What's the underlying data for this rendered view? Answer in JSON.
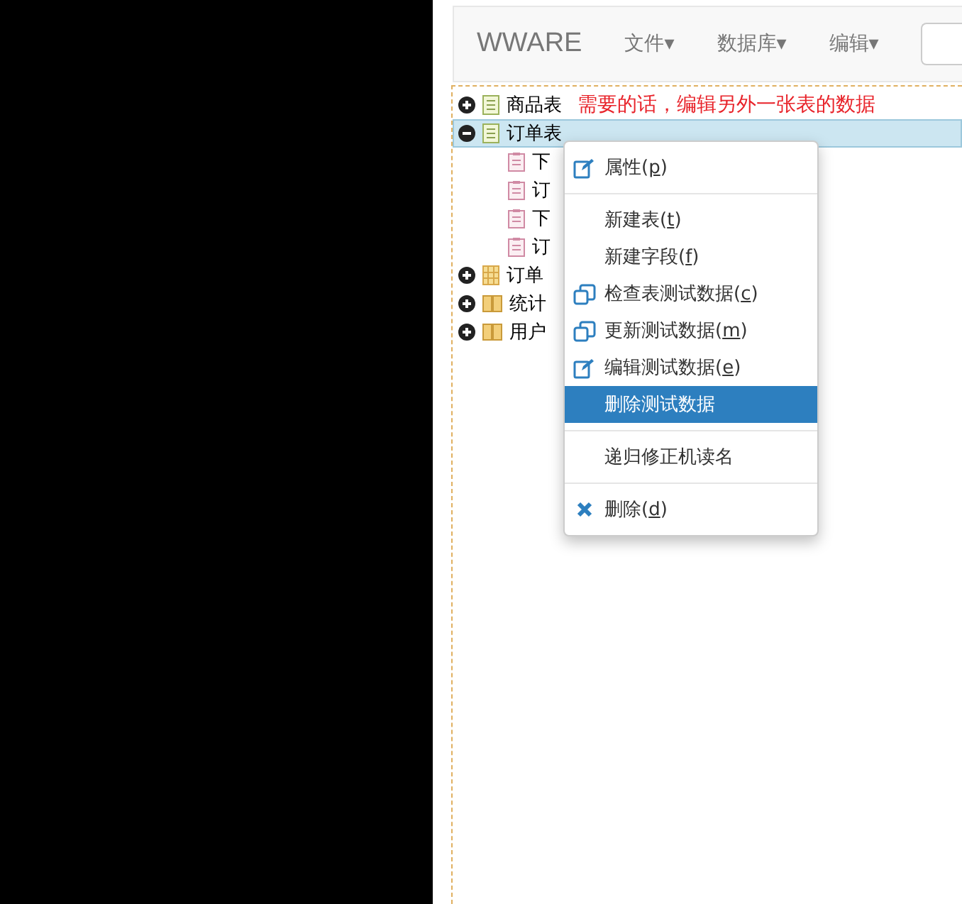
{
  "navbar": {
    "brand": "WWARE",
    "menus": [
      {
        "label": "文件",
        "caret": "▾"
      },
      {
        "label": "数据库",
        "caret": "▾"
      },
      {
        "label": "编辑",
        "caret": "▾"
      }
    ],
    "search": {
      "kind": "field"
    }
  },
  "tree": [
    {
      "label": "商品表",
      "kind": "table",
      "expanded": false,
      "selected": false,
      "note": "需要的话，编辑另外一张表的数据"
    },
    {
      "label": "订单表",
      "kind": "table",
      "expanded": true,
      "selected": true,
      "children": [
        {
          "label": "下",
          "kind": "form"
        },
        {
          "label": "订",
          "kind": "form"
        },
        {
          "label": "下",
          "kind": "form"
        },
        {
          "label": "订",
          "kind": "form"
        }
      ]
    },
    {
      "label": "订单",
      "kind": "grid",
      "expanded": false,
      "selected": false
    },
    {
      "label": "统计",
      "kind": "book",
      "expanded": false,
      "selected": false
    },
    {
      "label": "用户",
      "kind": "book",
      "expanded": false,
      "selected": false
    }
  ],
  "context_menu": [
    {
      "kind": "edit",
      "prefix": "属性(",
      "key": "p",
      "suffix": ")",
      "selected": false
    },
    {
      "kind": "separator"
    },
    {
      "kind": "plain",
      "prefix": "新建表(",
      "key": "t",
      "suffix": ")",
      "selected": false
    },
    {
      "kind": "plain",
      "prefix": "新建字段(",
      "key": "f",
      "suffix": ")",
      "selected": false
    },
    {
      "kind": "copy",
      "prefix": "检查表测试数据(",
      "key": "c",
      "suffix": ")",
      "selected": false
    },
    {
      "kind": "copy",
      "prefix": "更新测试数据(",
      "key": "m",
      "suffix": ")",
      "selected": false
    },
    {
      "kind": "edit",
      "prefix": "编辑测试数据(",
      "key": "e",
      "suffix": ")",
      "selected": false
    },
    {
      "kind": "plain",
      "prefix": "删除测试数据",
      "selected": true
    },
    {
      "kind": "separator"
    },
    {
      "kind": "plain",
      "prefix": "递归修正机读名",
      "selected": false
    },
    {
      "kind": "separator"
    },
    {
      "kind": "delete",
      "prefix": "删除(",
      "key": "d",
      "suffix": ")",
      "selected": false
    }
  ]
}
